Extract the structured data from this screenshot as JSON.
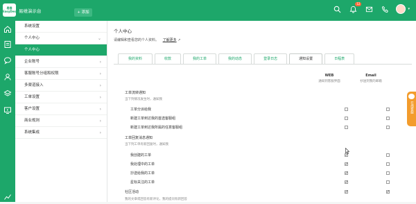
{
  "topbar": {
    "logo_text": "易维 EasyDesk",
    "app_title": "易维演示台",
    "add_label": "+ 添加",
    "notify_badge": "12",
    "icons": [
      "search-icon",
      "bell-icon",
      "mail-icon",
      "phone-icon",
      "avatar"
    ]
  },
  "rail": {
    "icons": [
      "home-icon",
      "ticket-icon",
      "chat-icon",
      "users-icon",
      "layers-icon",
      "monitor-icon",
      "chart-icon"
    ]
  },
  "menu": {
    "items": [
      {
        "label": "系统设置",
        "chevron": ""
      },
      {
        "label": "个人中心",
        "chevron": "⌄"
      },
      {
        "label": "个人中心",
        "chevron": "",
        "active": true
      },
      {
        "label": "企业账号",
        "chevron": "›"
      },
      {
        "label": "客服账号分组和权限",
        "chevron": "›"
      },
      {
        "label": "多渠道接入",
        "chevron": "›"
      },
      {
        "label": "工单设置",
        "chevron": "›"
      },
      {
        "label": "客户设置",
        "chevron": "›"
      },
      {
        "label": "商业规则",
        "chevron": "›"
      },
      {
        "label": "系统集成",
        "chevron": "›"
      }
    ]
  },
  "main": {
    "title": "个人中心",
    "subtitle": "请编辑和查看您的个人资料。",
    "more_link": "了解更多",
    "tabs": [
      "我的资料",
      "收款",
      "我的工单",
      "我的动态",
      "登录日志",
      "通知设置",
      "日程表"
    ],
    "active_tab": "通知设置",
    "web_head": "WEB",
    "web_sub": "通知到客服界面",
    "email_head": "Email",
    "email_sub": "抄送到我的邮箱",
    "rows": [
      {
        "type": "section",
        "label": "工单流转通知"
      },
      {
        "type": "sub",
        "label": "当下列情况发生时，通知我"
      },
      {
        "type": "item",
        "label": "工单分派给我",
        "web": false,
        "email": false
      },
      {
        "type": "item",
        "label": "新建工单到达我的首选客服组",
        "web": false,
        "email": false
      },
      {
        "type": "item",
        "label": "新建工单到达我所属的任意客服组",
        "web": false,
        "email": false
      },
      {
        "type": "section",
        "label": "工单回复消息通知"
      },
      {
        "type": "sub",
        "label": "当下列工单有新回复时，通知我"
      },
      {
        "type": "item",
        "label": "我创建的工单",
        "web": true,
        "email": false
      },
      {
        "type": "item",
        "label": "我处理中的工单",
        "web": true,
        "email": false
      },
      {
        "type": "item",
        "label": "抄送给我的工单",
        "web": true,
        "email": false
      },
      {
        "type": "item",
        "label": "星标关注的工单",
        "web": true,
        "email": false
      },
      {
        "type": "section",
        "label": "社区活动",
        "web": true,
        "email": true
      },
      {
        "type": "sub",
        "label": "我的文章或回答有新评论，我的提问有新回答"
      }
    ]
  },
  "float_tab": {
    "label": "在线客服"
  },
  "colors": {
    "brand": "#1da76a",
    "float": "#f39c2c"
  }
}
